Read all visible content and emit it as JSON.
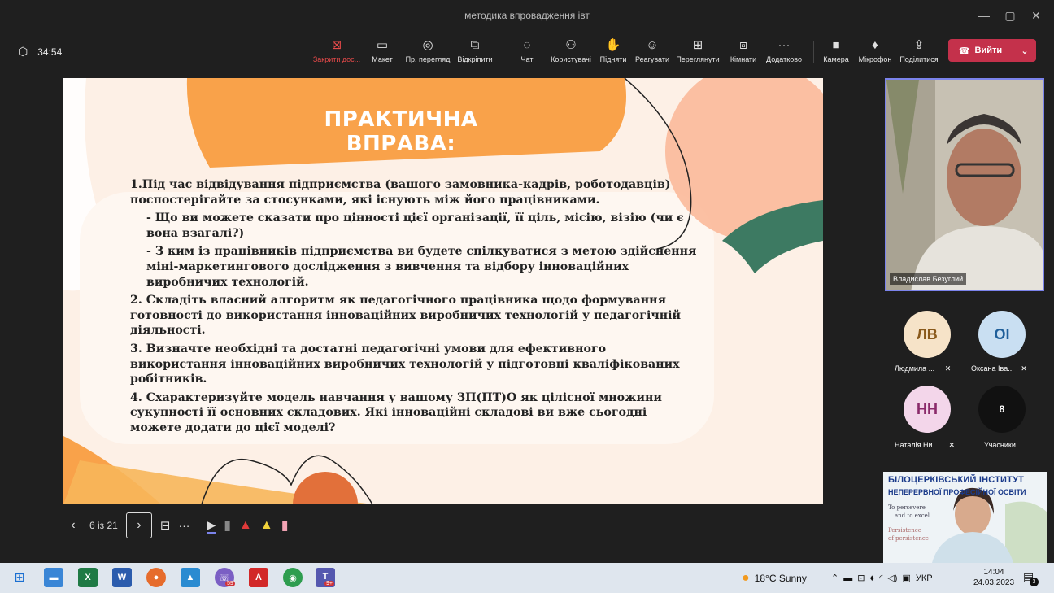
{
  "window": {
    "title": "методика впровадження івт"
  },
  "toolbar": {
    "timer": "34:54",
    "buttons": [
      {
        "label": "Закрити дос..."
      },
      {
        "label": "Макет"
      },
      {
        "label": "Пр. перегляд"
      },
      {
        "label": "Відкріпити"
      },
      {
        "label": "Чат"
      },
      {
        "label": "Користувачі"
      },
      {
        "label": "Підняти"
      },
      {
        "label": "Реагувати"
      },
      {
        "label": "Переглянути"
      },
      {
        "label": "Кімнати"
      },
      {
        "label": "Додатково"
      },
      {
        "label": "Камера"
      },
      {
        "label": "Мікрофон"
      },
      {
        "label": "Поділитися"
      }
    ],
    "leave_label": "Вийти"
  },
  "slide": {
    "title": "ПРАКТИЧНА  ВПРАВА:",
    "p1": "1.Під час відвідування підприємства (вашого замовника-кадрів, роботодавців) поспостерігайте за стосунками, які існують між його працівниками.",
    "p1a": "-  Що ви можете сказати про цінності цієї організації, її ціль, місію, візію (чи є вона взагалі?)",
    "p1b": "-  З ким із працівників підприємства ви будете спілкуватися  з метою здійснення міні-маркетингового дослідження з вивчення та відбору інноваційних виробничих технологій.",
    "p2": "2. Складіть власний алгоритм як педагогічного працівника щодо формування готовності до використання інноваційних виробничих технологій у педагогічній діяльності.",
    "p3": "3. Визначте необхідні та достатні педагогічні умови для ефективного використання інноваційних виробничих технологій у підготовці кваліфікованих робітників.",
    "p4": "4. Схарактеризуйте модель навчання у вашому ЗП(ПТ)О  як цілісної множини сукупності її основних складових. Які інноваційні складові ви вже сьогодні можете додати до цієї моделі?"
  },
  "slide_controls": {
    "page": "6 із 21"
  },
  "participants": {
    "video_name": "Владислав Безуглий",
    "people": [
      {
        "initials": "ЛВ",
        "name": "Людмила ...",
        "color": "#f6e3c8",
        "text_color": "#8a5a1c"
      },
      {
        "initials": "ОІ",
        "name": "Оксана Іва...",
        "color": "#c9dff2",
        "text_color": "#1f5f9a"
      },
      {
        "initials": "НН",
        "name": "Наталія Ни...",
        "color": "#f3d6ea",
        "text_color": "#8a2a6a"
      }
    ],
    "others_count": "8",
    "others_label": "Учасники"
  },
  "mini_share": {
    "line1": "БІЛОЦЕРКІВСЬКИЙ ІНСТИТУТ",
    "line2": "НЕПЕРЕРВНОЇ ПРОФЕСІЙНОЇ ОСВІТИ",
    "line3": "To persevere",
    "line4": "and to excel",
    "line5": "Persistence",
    "line6": "of persistence"
  },
  "taskbar": {
    "weather": "18°C  Sunny",
    "lang": "УКР",
    "time": "14:04",
    "date": "24.03.2023",
    "notif_count": "3",
    "badge_teams": "9+",
    "badge_viber": "59"
  }
}
